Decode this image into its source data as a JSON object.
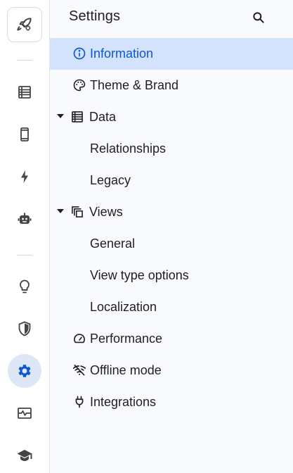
{
  "header": {
    "title": "Settings",
    "search_icon": "search-icon"
  },
  "rail": {
    "logo_icon": "rocket-icon",
    "items": [
      {
        "icon": "table-icon"
      },
      {
        "icon": "phone-icon"
      },
      {
        "icon": "bolt-icon"
      },
      {
        "icon": "robot-icon"
      },
      {
        "icon": "lightbulb-icon"
      },
      {
        "icon": "shield-icon"
      },
      {
        "icon": "gear-icon",
        "active": true
      },
      {
        "icon": "monitor-pulse-icon"
      },
      {
        "icon": "graduation-cap-icon"
      }
    ]
  },
  "nav": {
    "information": "Information",
    "theme_brand": "Theme & Brand",
    "data": "Data",
    "relationships": "Relationships",
    "legacy": "Legacy",
    "views": "Views",
    "general": "General",
    "view_type_options": "View type options",
    "localization": "Localization",
    "performance": "Performance",
    "offline_mode": "Offline mode",
    "integrations": "Integrations"
  },
  "colors": {
    "accent": "#0b57d0",
    "active_bg": "#d3e3fd",
    "rail_active_bg": "#dde6f5",
    "panel_bg": "#f8fafd"
  }
}
